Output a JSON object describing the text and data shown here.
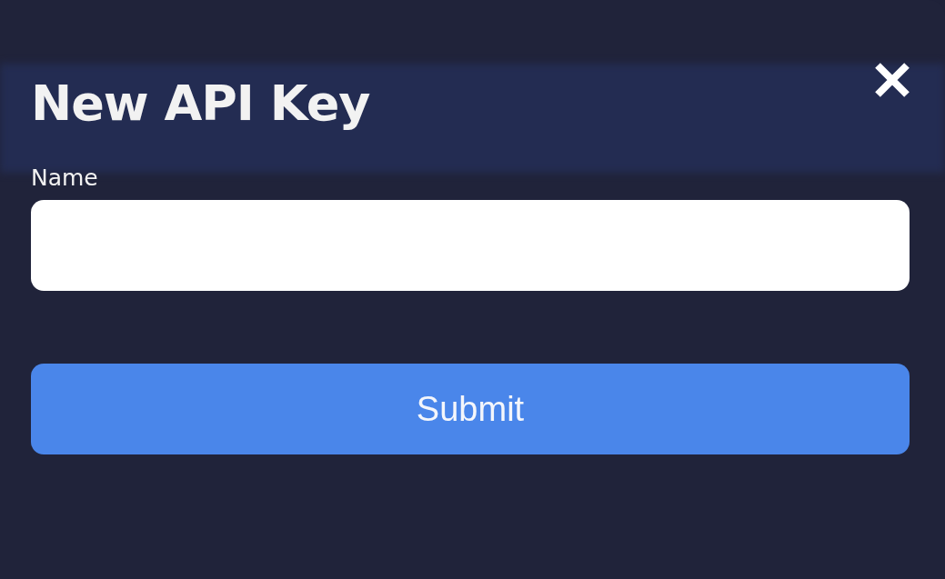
{
  "dialog": {
    "title": "New API Key",
    "fields": [
      {
        "label": "Name"
      }
    ],
    "submit": "Submit"
  }
}
